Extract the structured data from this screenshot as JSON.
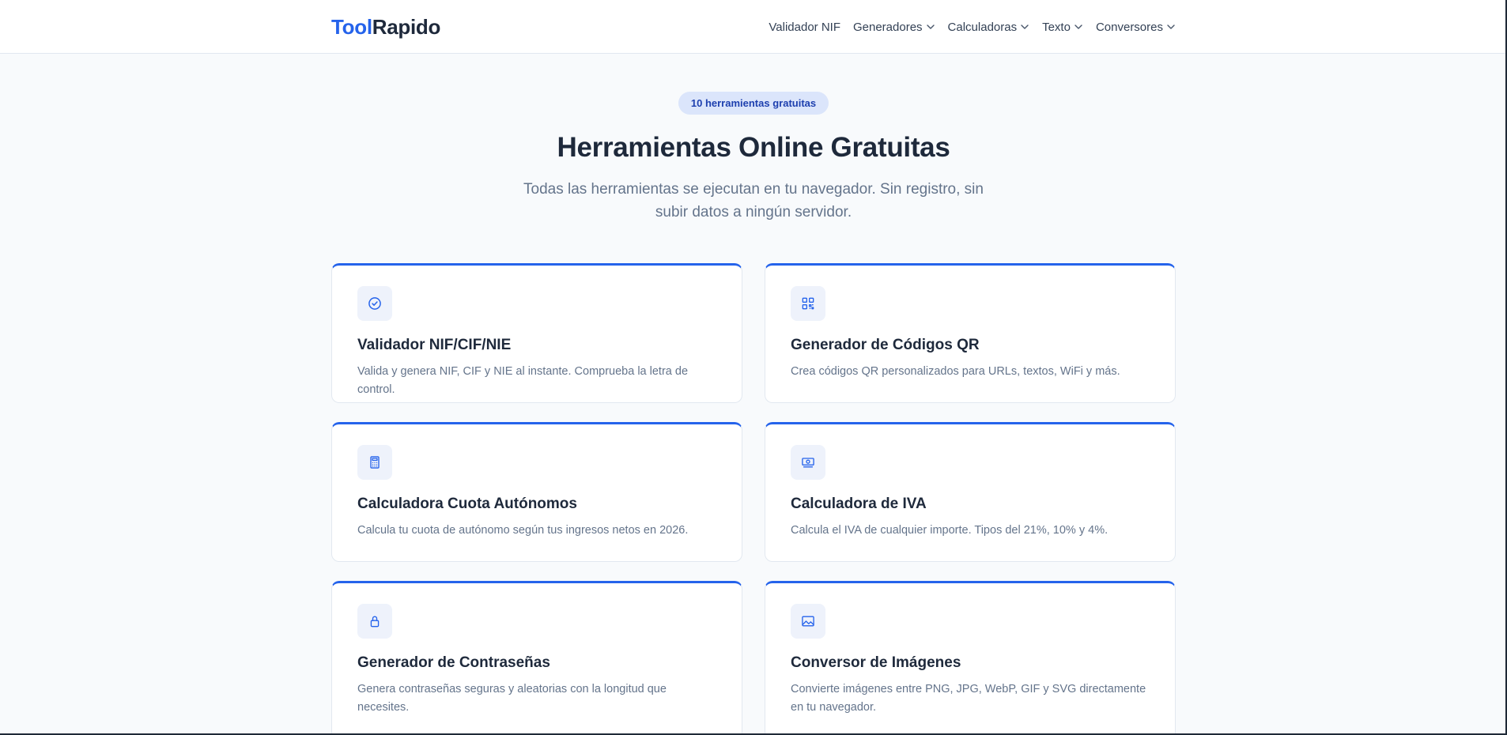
{
  "header": {
    "logo_part1": "Tool",
    "logo_part2": "Rapido",
    "nav": [
      {
        "label": "Validador NIF",
        "has_dropdown": false
      },
      {
        "label": "Generadores",
        "has_dropdown": true
      },
      {
        "label": "Calculadoras",
        "has_dropdown": true
      },
      {
        "label": "Texto",
        "has_dropdown": true
      },
      {
        "label": "Conversores",
        "has_dropdown": true
      }
    ]
  },
  "hero": {
    "badge": "10 herramientas gratuitas",
    "title": "Herramientas Online Gratuitas",
    "subtitle": "Todas las herramientas se ejecutan en tu navegador. Sin registro, sin subir datos a ningún servidor."
  },
  "tools": [
    {
      "icon": "check-circle-icon",
      "title": "Validador NIF/CIF/NIE",
      "description": "Valida y genera NIF, CIF y NIE al instante. Comprueba la letra de control."
    },
    {
      "icon": "qr-code-icon",
      "title": "Generador de Códigos QR",
      "description": "Crea códigos QR personalizados para URLs, textos, WiFi y más."
    },
    {
      "icon": "calculator-icon",
      "title": "Calculadora Cuota Autónomos",
      "description": "Calcula tu cuota de autónomo según tus ingresos netos en 2026."
    },
    {
      "icon": "money-icon",
      "title": "Calculadora de IVA",
      "description": "Calcula el IVA de cualquier importe. Tipos del 21%, 10% y 4%."
    },
    {
      "icon": "lock-icon",
      "title": "Generador de Contraseñas",
      "description": "Genera contraseñas seguras y aleatorias con la longitud que necesites."
    },
    {
      "icon": "image-icon",
      "title": "Conversor de Imágenes",
      "description": "Convierte imágenes entre PNG, JPG, WebP, GIF y SVG directamente en tu navegador."
    }
  ],
  "colors": {
    "accent": "#2563eb",
    "text": "#1e293b",
    "muted": "#64748b",
    "background": "#f8fafc"
  }
}
